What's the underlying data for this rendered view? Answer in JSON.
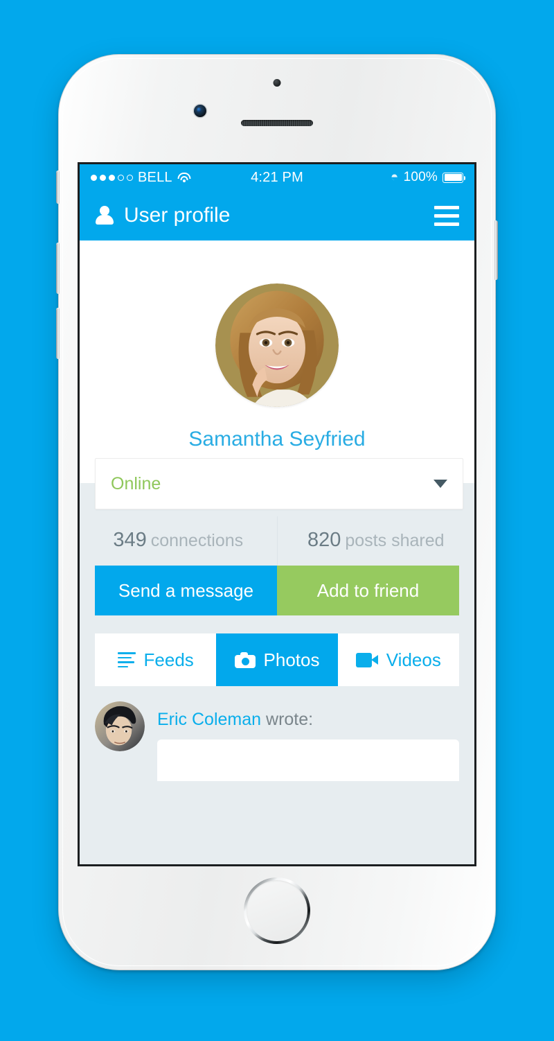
{
  "theme": {
    "brand_blue": "#02a8ec",
    "link_blue": "#0aaeeb",
    "green": "#96ca5f",
    "status_green": "#8fc75b",
    "screen_bg": "#e7edf0"
  },
  "status_bar": {
    "signal_dots_filled": 3,
    "signal_dots_total": 5,
    "carrier": "BELL",
    "wifi_icon": "wifi-icon",
    "time": "4:21 PM",
    "bluetooth_icon": "bluetooth-icon",
    "battery_percent": "100%",
    "battery_icon": "battery-full-icon"
  },
  "navbar": {
    "user_icon": "user-icon",
    "title": "User profile",
    "menu_icon": "hamburger-menu-icon"
  },
  "profile": {
    "avatar_alt": "profile-photo",
    "name": "Samantha Seyfried"
  },
  "status_select": {
    "value": "Online",
    "caret_icon": "chevron-down-icon"
  },
  "stats": [
    {
      "value": "349",
      "label": "connections"
    },
    {
      "value": "820",
      "label": "posts shared"
    }
  ],
  "actions": [
    {
      "label": "Send a message",
      "style": "blue"
    },
    {
      "label": "Add to friend",
      "style": "green"
    }
  ],
  "tabs": [
    {
      "label": "Feeds",
      "icon": "feeds-list-icon",
      "active": false
    },
    {
      "label": "Photos",
      "icon": "camera-icon",
      "active": true
    },
    {
      "label": "Videos",
      "icon": "video-camera-icon",
      "active": false
    }
  ],
  "feed": {
    "author": "Eric Coleman",
    "suffix": " wrote:",
    "author_avatar_alt": "eric-coleman-avatar"
  }
}
